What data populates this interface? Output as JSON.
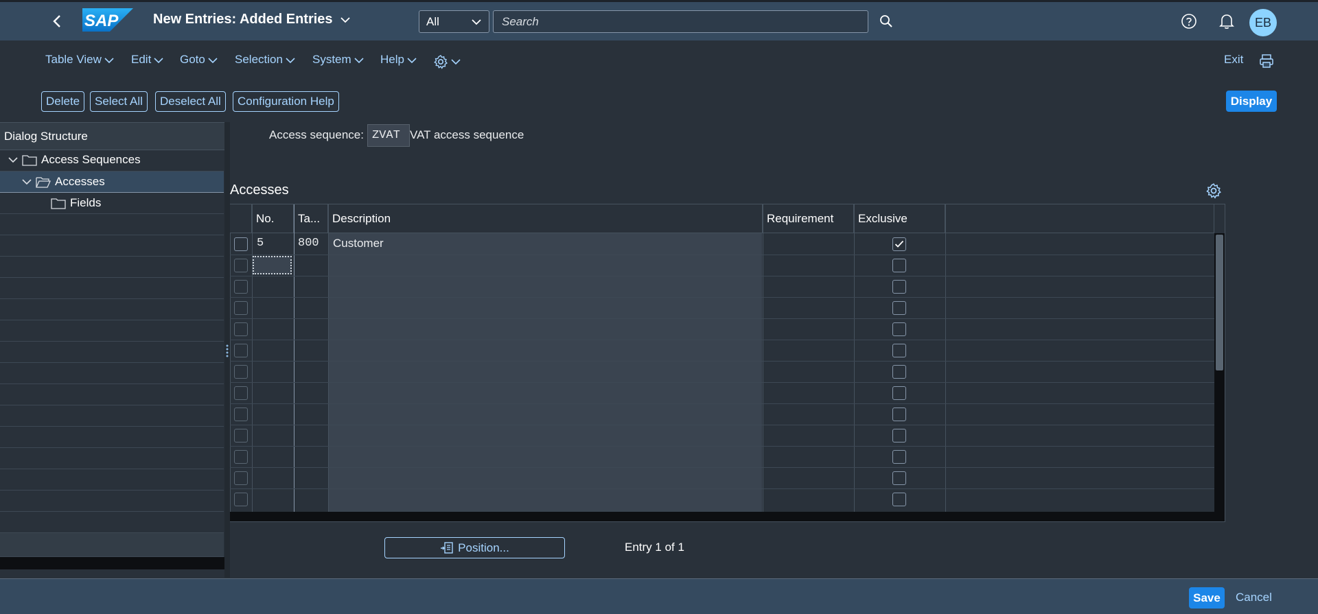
{
  "shell": {
    "title": "New Entries: Added Entries",
    "logo_text": "SAP",
    "scope": "All",
    "search_placeholder": "Search",
    "avatar_initials": "EB"
  },
  "menu": {
    "items": [
      "Table View",
      "Edit",
      "Goto",
      "Selection",
      "System",
      "Help"
    ],
    "exit": "Exit"
  },
  "toolbar": {
    "delete": "Delete",
    "select_all": "Select All",
    "deselect_all": "Deselect All",
    "config_help": "Configuration Help",
    "display": "Display"
  },
  "dialog_structure": {
    "title": "Dialog Structure",
    "nodes": [
      "Access Sequences",
      "Accesses",
      "Fields"
    ]
  },
  "header": {
    "label": "Access sequence:",
    "value": "ZVAT",
    "description": "VAT access sequence"
  },
  "table": {
    "title": "Accesses",
    "columns": [
      "No.",
      "Ta...",
      "Description",
      "Requirement",
      "Exclusive"
    ],
    "rows": [
      {
        "no": "5",
        "table": "800",
        "description": "Customer",
        "requirement": "",
        "exclusive": true
      }
    ],
    "empty_rows": 12
  },
  "table_footer": {
    "position": "Position...",
    "entry_count": "Entry 1 of 1"
  },
  "footer": {
    "save": "Save",
    "cancel": "Cancel"
  },
  "colors": {
    "shell": "#354a5f",
    "background": "#29313a",
    "accent": "#1c86e8",
    "link": "#a6d4ff"
  }
}
